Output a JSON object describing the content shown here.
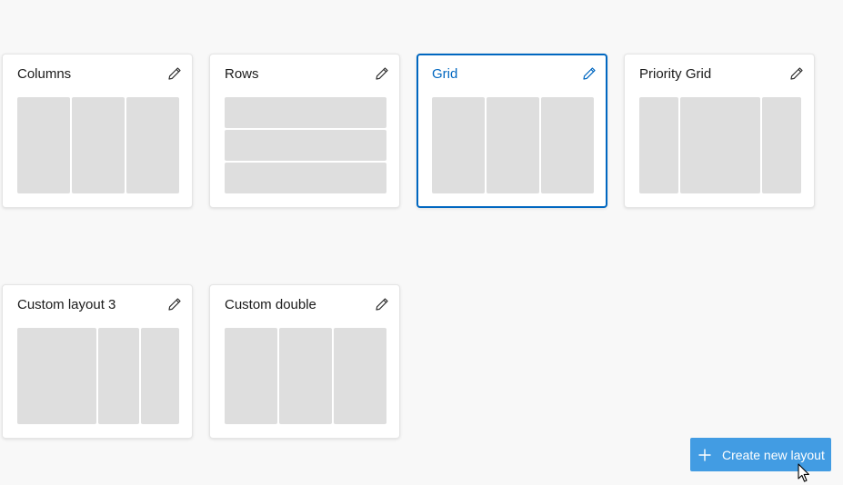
{
  "layouts_row1": [
    {
      "title": "Columns",
      "edit_icon": "pencil-icon",
      "selected": false
    },
    {
      "title": "Rows",
      "edit_icon": "pencil-icon",
      "selected": false
    },
    {
      "title": "Grid",
      "edit_icon": "pencil-icon",
      "selected": true
    },
    {
      "title": "Priority Grid",
      "edit_icon": "pencil-icon",
      "selected": false
    }
  ],
  "layouts_row2": [
    {
      "title": "Custom layout 3",
      "edit_icon": "pencil-icon",
      "selected": false
    },
    {
      "title": "Custom double",
      "edit_icon": "pencil-icon",
      "selected": false
    }
  ],
  "create_button": {
    "label": "Create new layout",
    "icon": "plus-icon"
  },
  "colors": {
    "accent": "#0067c0",
    "button_bg": "#429ce3",
    "zone": "#dedede",
    "background": "#f8f8f8"
  }
}
